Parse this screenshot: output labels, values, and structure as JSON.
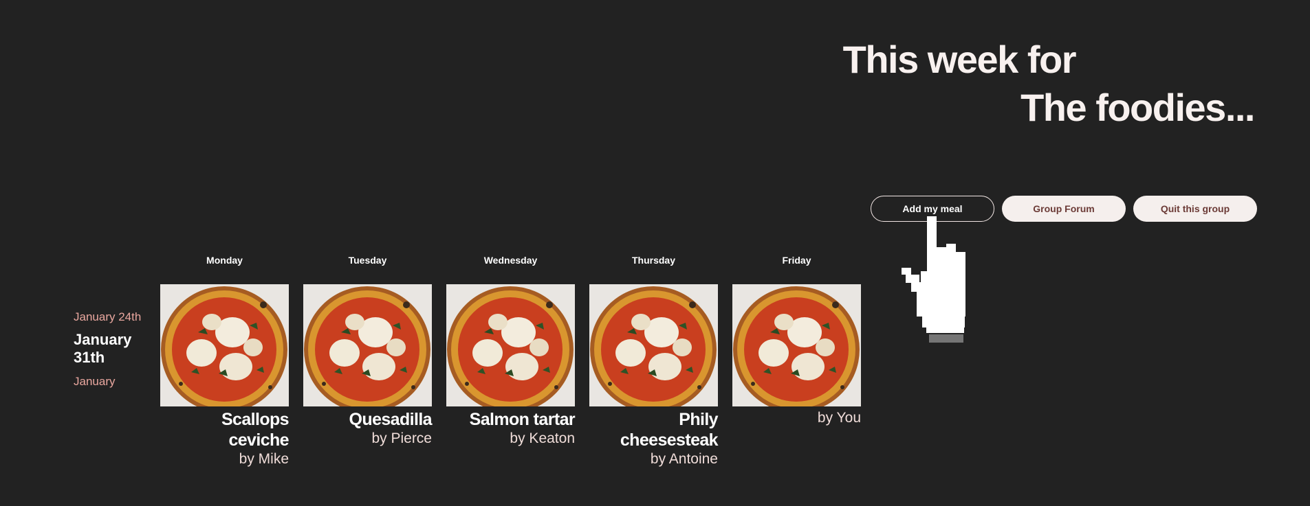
{
  "hero": {
    "line1": "This week for",
    "line2": "The foodies..."
  },
  "actions": {
    "add_meal": "Add my meal",
    "forum": "Group Forum",
    "quit": "Quit this group"
  },
  "dates": {
    "previous": "January 24th",
    "current": "January 31th",
    "next": "January"
  },
  "days": [
    {
      "day": "Monday",
      "meal": "Scallops ceviche",
      "by": "by Mike"
    },
    {
      "day": "Tuesday",
      "meal": "Quesadilla",
      "by": "by Pierce"
    },
    {
      "day": "Wednesday",
      "meal": "Salmon tartar",
      "by": "by Keaton"
    },
    {
      "day": "Thursday",
      "meal": "Phily cheesesteak",
      "by": "by Antoine"
    },
    {
      "day": "Friday",
      "meal": "",
      "by": "by You"
    }
  ],
  "icons": {
    "cursor": "pointer-hand-icon",
    "meal_image": "pizza-image"
  },
  "colors": {
    "background": "#222222",
    "accent": "#e9a79f",
    "button": "#f5efed",
    "button_text": "#6b3a36"
  }
}
